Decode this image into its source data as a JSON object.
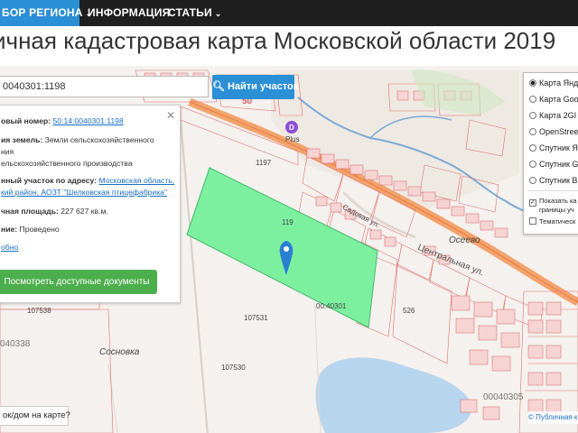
{
  "nav": {
    "items": [
      {
        "label": "БОР РЕГИОНА",
        "chevron": "⌄"
      },
      {
        "label": "ИНФОРМАЦИЯ"
      },
      {
        "label": "СТАТЬИ",
        "chevron": "⌄"
      }
    ],
    "active_color": "#2b8fd6"
  },
  "page": {
    "title": "ичная кадастровая карта Московской области 2019"
  },
  "search": {
    "value": "0040301:1198",
    "button_label": "Найти участок",
    "button_icon": "search-icon"
  },
  "info_panel": {
    "cad_number_label": "овый номер:",
    "cad_number_value": "50:14:0040301:1198",
    "land_category_label": "ия земель:",
    "land_category_value_line1": "Земли сельскохозяйственного",
    "land_category_value_line2": "ния",
    "land_category_value_line3": "ельскохозяйственного производства",
    "address_label": "нный участок по адресу:",
    "address_value_line1": "Московская область,",
    "address_value_line2": "кий район, АОЗТ \"Шелковская птицефабрика\"",
    "area_label": "чная площадь:",
    "area_value": "227 627 кв.м.",
    "status_label": "ние:",
    "status_value": "Проведено",
    "more_link": "обно",
    "docs_button": "Посмотреть доступные документы"
  },
  "layers_panel": {
    "base_layers": [
      {
        "label": "Карта Янд",
        "selected": true
      },
      {
        "label": "Карта Goo",
        "selected": false
      },
      {
        "label": "Карта 2GI",
        "selected": false
      },
      {
        "label": "OpenStree",
        "selected": false
      },
      {
        "label": "Спутник Я",
        "selected": false
      },
      {
        "label": "Спутник G",
        "selected": false
      },
      {
        "label": "Спутник B",
        "selected": false
      }
    ],
    "option_show_line1": "Показать ка",
    "option_show_line2": "границы уч",
    "option_show_checked": true,
    "option_thematic": "Тематическ",
    "option_thematic_checked": false
  },
  "map": {
    "labels": {
      "place_osevo": "Осеево",
      "street_central": "Центральная ул.",
      "street_sadovaya": "Садовая ул.",
      "place_sosnovka": "Сосновка",
      "poi_plus": "Plus",
      "road_number": "50",
      "parcel_1197": "1197",
      "parcel_1198": "119",
      "parcel_107531": "107531",
      "parcel_107530": "107530",
      "parcel_107538": "107538",
      "parcel_526": "526",
      "quarter_40301": "00:40301",
      "quarter_40305": "00040305",
      "quarter_40338": "040338"
    },
    "highlight_color": "#7df0a0",
    "boundary_color": "#e05050"
  },
  "bottom": {
    "question": "ок/дом на карте?",
    "attribution": "© Публичная када"
  }
}
